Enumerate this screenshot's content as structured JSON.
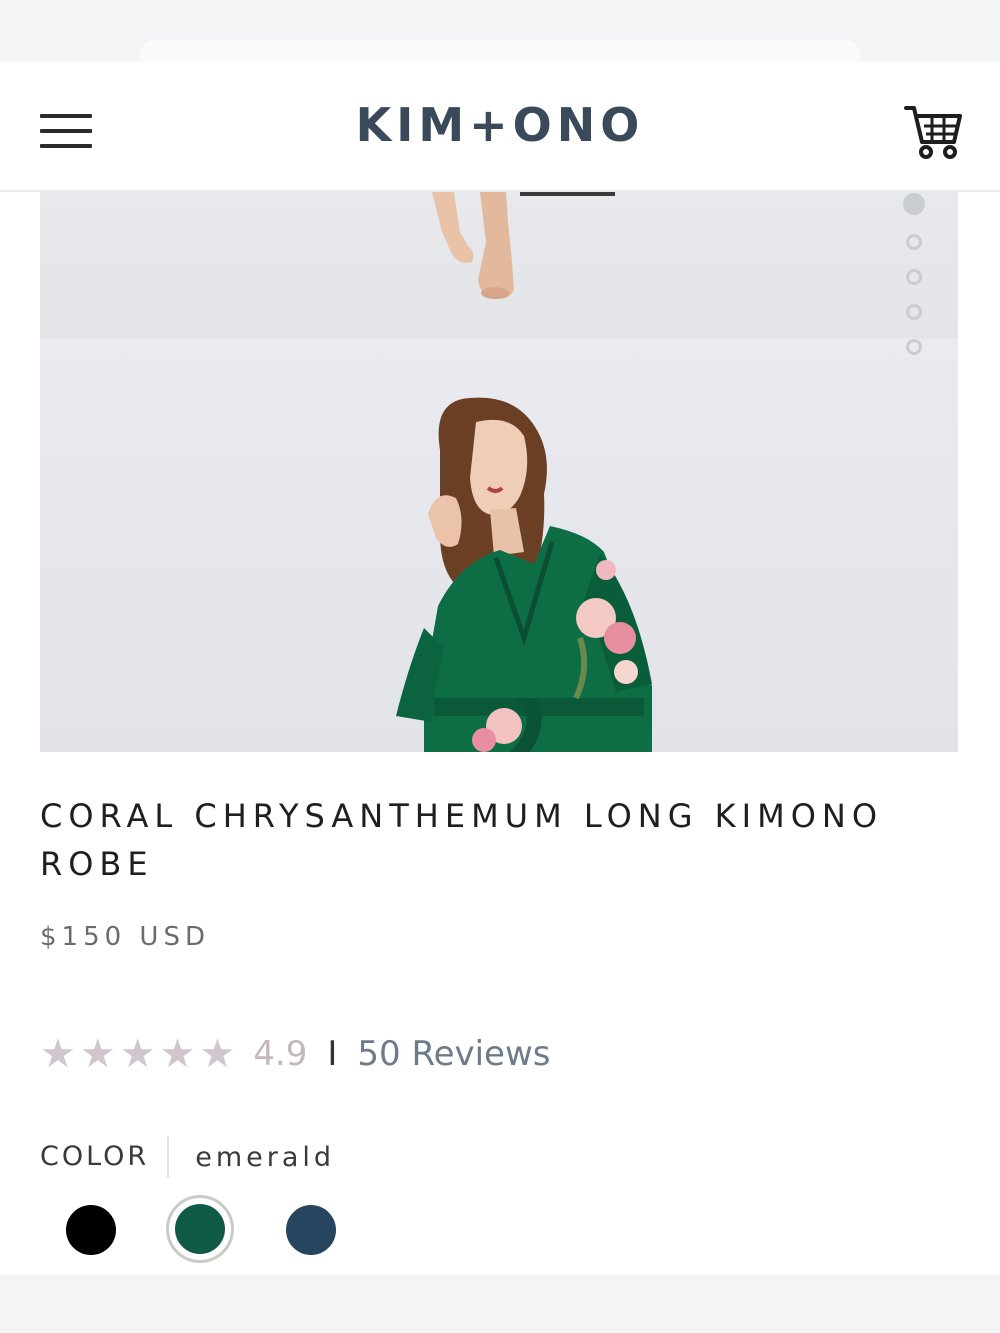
{
  "header": {
    "logo": "KIM+ONO",
    "menu_icon": "hamburger-menu-icon",
    "cart_icon": "shopping-cart-icon"
  },
  "gallery": {
    "slide_count": 5,
    "active_slide": 1
  },
  "product": {
    "title": "CORAL CHRYSANTHEMUM LONG KIMONO ROBE",
    "price": "$150 USD",
    "rating_value": "4.9",
    "rating_stars": 5,
    "rating_separator": "I",
    "reviews_label": "50 Reviews",
    "color_label": "COLOR",
    "selected_color": "emerald",
    "swatches": [
      {
        "name": "black",
        "hex": "#000000"
      },
      {
        "name": "emerald",
        "hex": "#0e5a47",
        "selected": true
      },
      {
        "name": "navy",
        "hex": "#27455e"
      }
    ]
  },
  "colors": {
    "logo": "#3b4a5a",
    "star": "#d2c6ce",
    "rating_value": "#c2b7bf",
    "reviews_link": "#6d7b8c",
    "robe_green": "#0d6e46"
  }
}
